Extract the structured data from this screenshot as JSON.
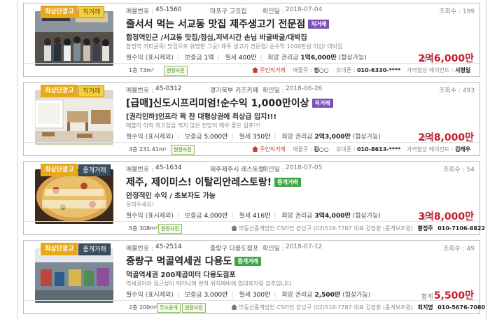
{
  "listings": [
    {
      "premium_label": "최상단광고",
      "type_label": "직거래",
      "type_kind": "direct",
      "number_label": "매물번호 :",
      "number": "45-1560",
      "region": "마포구 고깃집",
      "date_label": "확인일 :",
      "date": "2018-07-04",
      "views": "조회수 : 199",
      "title": "줄서서 먹는 서교동 맛집 제주생고기 전문점",
      "tag": "직거래",
      "subtitle": "합정역인근 /서교동 맛집/점심,저녁시간 손님 바글바글/대박집",
      "desc": "합정역 커피골목/ 맛집으로 유명한 그곳/ 제주 생고기 전문점/ 순수익 1000만원 이상/ 대박집",
      "deposit_label": "보증금",
      "deposit": "1억",
      "rent_label": "월세",
      "rent": "400만",
      "premium_price_label": "희망 권리금",
      "premium_price": "1억6,000만",
      "negotiable": "(협상가능)",
      "monthly_label": "월수익",
      "monthly": "(표시제외)",
      "total_label": "합계",
      "total": "2억6,000만",
      "area": "1층 73m²",
      "pills": [
        "현장사진"
      ],
      "contact": {
        "owner": "주인직거래",
        "seller_label": "매물주 :",
        "seller": "정○○",
        "phone_label": "휴대폰 :",
        "phone": "010-6330-****",
        "agent_label": "가격협상 에이전트 :",
        "agent": "서형일"
      }
    },
    {
      "premium_label": "최상단광고",
      "type_label": "직거래",
      "type_kind": "direct",
      "number_label": "매물번호 :",
      "number": "45-0312",
      "region": "경기북부 키즈카페",
      "date_label": "확인일 :",
      "date": "2018-06-26",
      "views": "조회수 : 493",
      "title": "[급매]신도시프리미엄!순수익 1,000만이상",
      "tag": "직거래",
      "subtitle": "[권리인하]인프라 꽉 찬 대형상권에 최상급 입지!!!",
      "desc": "매출이 이직 최고점을 찍지 않은 전망이 매우 좋은 점포!!!",
      "deposit_label": "보증금",
      "deposit": "5,000만",
      "rent_label": "월세",
      "rent": "350만",
      "premium_price_label": "희망 권리금",
      "premium_price": "2억3,000만",
      "negotiable": "(협상가능)",
      "monthly_label": "월수익",
      "monthly": "(표시제외)",
      "total_label": "합계",
      "total": "2억8,000만",
      "area": "3층 231.41m²",
      "pills": [
        "현장사진"
      ],
      "contact": {
        "owner": "주인직거래",
        "seller_label": "매물주 :",
        "seller": "김○○",
        "phone_label": "휴대폰 :",
        "phone": "010-8613-****",
        "agent_label": "가격협상 에이전트 :",
        "agent": "김태우"
      }
    },
    {
      "premium_label": "최상단광고",
      "type_label": "중개거래",
      "type_kind": "broker",
      "number_label": "매물번호 :",
      "number": "45-1634",
      "region": "제주제주시 레스토랑",
      "date_label": "확인일 :",
      "date": "2018-07-05",
      "views": "조회수 : 54",
      "title": "제주, 제이미스! 이탈리안레스토랑!",
      "tag": "중개거래",
      "subtitle": "안정적인 수익 / 초보자도 가능",
      "desc": "문의주세요!",
      "deposit_label": "보증금",
      "deposit": "4,000만",
      "rent_label": "월세",
      "rent": "416만",
      "premium_price_label": "희망 권리금",
      "premium_price": "3억4,000만",
      "negotiable": "(협상가능)",
      "monthly_label": "월수익",
      "monthly": "(표시제외)",
      "total_label": "합계",
      "total": "3억8,000만",
      "area": "5층 308m²",
      "pills": [
        "현장사진"
      ],
      "contact": {
        "broker": "부동산중개법인 CS라인 강남구 (02)518-7787 대표 김정환 (중개보조원)",
        "agent": "황정주",
        "phone": "010-7106-8822"
      }
    },
    {
      "premium_label": "최상단광고",
      "type_label": "중개거래",
      "type_kind": "broker",
      "number_label": "매물번호 :",
      "number": "45-2514",
      "region": "중랑구 다용도점포",
      "date_label": "확인일 :",
      "date": "2018-07-12",
      "views": "조회수 : 49",
      "title": "중랑구 먹골역세권 다용도",
      "tag": "중개거래",
      "subtitle": "먹골역세권 200제곱미터 다용도점포",
      "desc": "역세권이라 접근성이 뛰어나며 면적 위치예비에 입대료저렴 강추입니다",
      "deposit_label": "보증금",
      "deposit": "3,000만",
      "rent_label": "월세",
      "rent": "300만",
      "premium_price_label": "희망 권리금",
      "premium_price": "2,500만",
      "negotiable": "(협상가능)",
      "monthly_label": "월수익",
      "monthly": "(표시제외)",
      "total_label": "합계",
      "total": "5,500만",
      "area": "2층 200m²",
      "pills": [
        "무소공개",
        "현장사진"
      ],
      "contact": {
        "broker": "부동산중개법인 CS라인 강남구 (02)518-7787 대표 김정환 (중개보조원)",
        "agent": "최지명",
        "phone": "010-5676-7080"
      }
    }
  ]
}
